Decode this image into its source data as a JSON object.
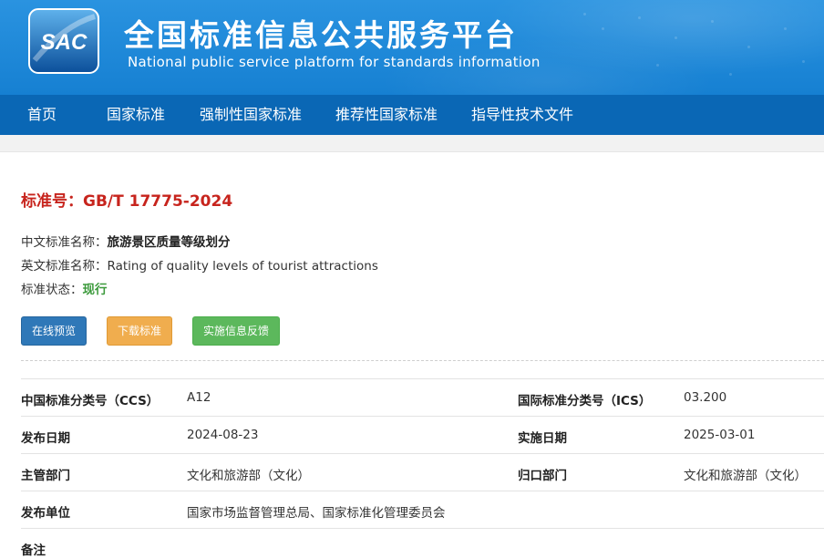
{
  "header": {
    "logo_text": "SAC",
    "title_cn": "全国标准信息公共服务平台",
    "title_en": "National public service platform  for standards information"
  },
  "nav": {
    "items": [
      {
        "label": "首页"
      },
      {
        "label": "国家标准"
      },
      {
        "label": "强制性国家标准"
      },
      {
        "label": "推荐性国家标准"
      },
      {
        "label": "指导性技术文件"
      }
    ]
  },
  "standard": {
    "number_label": "标准号：",
    "number": "GB/T 17775-2024",
    "cn_name_label": "中文标准名称：",
    "cn_name": "旅游景区质量等级划分",
    "en_name_label": "英文标准名称：",
    "en_name": "Rating of quality levels of tourist attractions",
    "status_label": "标准状态：",
    "status": "现行"
  },
  "buttons": {
    "preview": "在线预览",
    "download": "下载标准",
    "feedback": "实施信息反馈"
  },
  "details": {
    "ccs_label": "中国标准分类号（CCS）",
    "ccs_value": "A12",
    "ics_label": "国际标准分类号（ICS）",
    "ics_value": "03.200",
    "publish_date_label": "发布日期",
    "publish_date": "2024-08-23",
    "implement_date_label": "实施日期",
    "implement_date": "2025-03-01",
    "authority_label": "主管部门",
    "authority": "文化和旅游部（文化）",
    "centralized_label": "归口部门",
    "centralized": "文化和旅游部（文化）",
    "issuer_label": "发布单位",
    "issuer": "国家市场监督管理总局、国家标准化管理委员会",
    "remark_label": "备注"
  },
  "colors": {
    "header_blue": "#1a86d8",
    "nav_blue": "#0a67b5",
    "std_number_red": "#c7241d",
    "status_green": "#3c9a3c",
    "btn_preview": "#2f78b8",
    "btn_download": "#f0ad4e",
    "btn_feedback": "#5cb85c"
  }
}
